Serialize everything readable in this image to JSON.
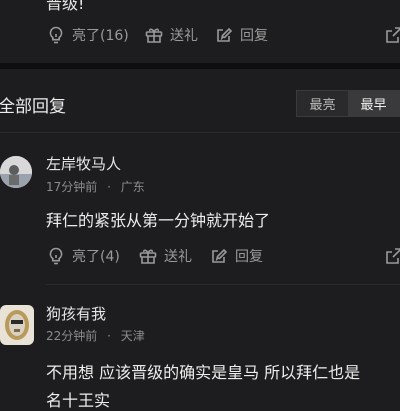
{
  "prev_comment": {
    "text_tail": "晋级!",
    "actions": {
      "like": "亮了(16)",
      "gift": "送礼",
      "reply": "回复"
    }
  },
  "section": {
    "title": "全部回复",
    "sort_options": [
      "最亮",
      "最早"
    ],
    "sort_selected": "最早"
  },
  "comments": [
    {
      "username": "左岸牧马人",
      "time": "17分钟前",
      "location": "广东",
      "text": "拜仁的紧张从第一分钟就开始了",
      "actions": {
        "like": "亮了(4)",
        "gift": "送礼",
        "reply": "回复"
      }
    },
    {
      "username": "狗孩有我",
      "time": "22分钟前",
      "location": "天津",
      "text": "不用想 应该晋级的确实是皇马 所以拜仁也是",
      "text_line2": "名十王实"
    }
  ],
  "separator": "·",
  "colors": {
    "background": "#1d1d1f",
    "divider": "#0e0e10",
    "text": "#e6e6e6",
    "muted": "#8c8c8c"
  }
}
